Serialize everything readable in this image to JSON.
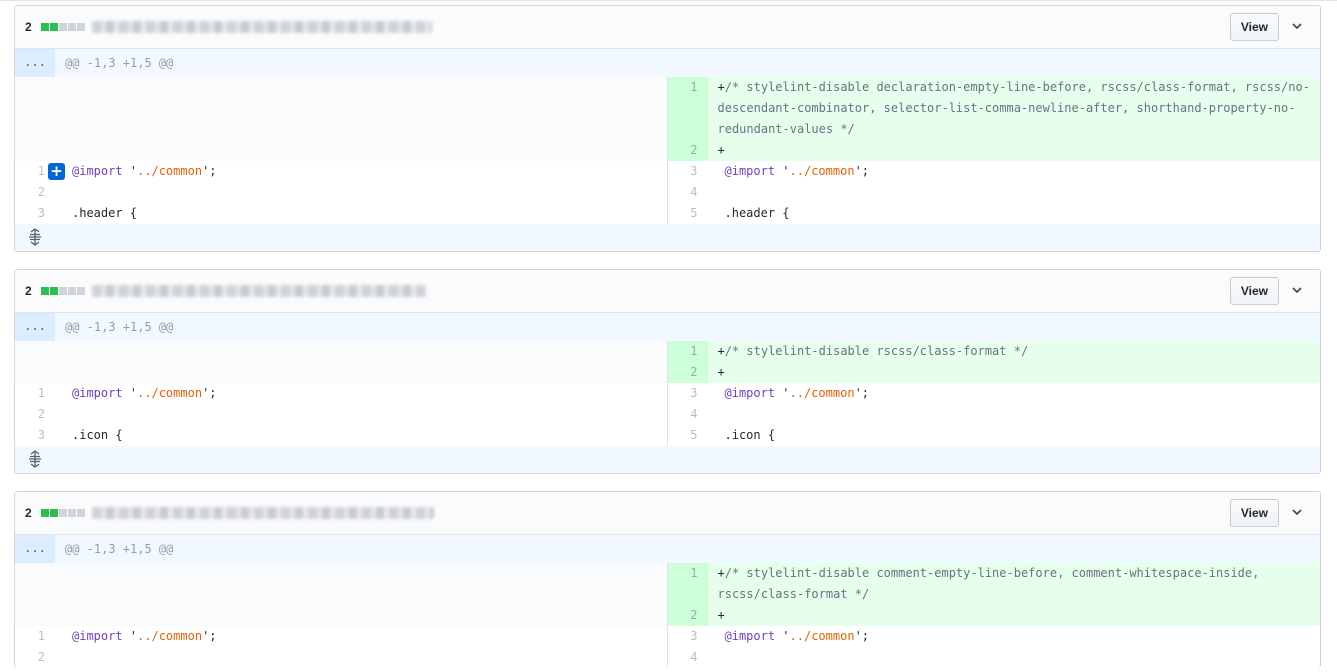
{
  "files": [
    {
      "diffstat": "2",
      "view_label": "View",
      "hunk_dots": "...",
      "hunk_header": "@@ -1,3 +1,5 @@",
      "added": [
        {
          "num": "1",
          "prefix": "+",
          "text": "/* stylelint-disable declaration-empty-line-before, rscss/class-format, rscss/no-descendant-combinator, selector-list-comma-newline-after, shorthand-property-no-redundant-values */"
        },
        {
          "num": "2",
          "prefix": "+",
          "text": ""
        }
      ],
      "left": [
        {
          "num": "1",
          "text_a": "@import",
          "text_b": " '",
          "text_c": "../common",
          "text_d": "';"
        },
        {
          "num": "2",
          "text_a": "",
          "text_b": "",
          "text_c": "",
          "text_d": ""
        },
        {
          "num": "3",
          "text_a": "",
          "text_b": ".header {",
          "text_c": "",
          "text_d": ""
        }
      ],
      "right": [
        {
          "num": "3",
          "text_a": "@import",
          "text_b": " '",
          "text_c": "../common",
          "text_d": "';"
        },
        {
          "num": "4",
          "text_a": "",
          "text_b": "",
          "text_c": "",
          "text_d": ""
        },
        {
          "num": "5",
          "text_a": "",
          "text_b": ".header {",
          "text_c": "",
          "text_d": ""
        }
      ],
      "add_button": "+"
    },
    {
      "diffstat": "2",
      "view_label": "View",
      "hunk_dots": "...",
      "hunk_header": "@@ -1,3 +1,5 @@",
      "added": [
        {
          "num": "1",
          "prefix": "+",
          "text": "/* stylelint-disable rscss/class-format */"
        },
        {
          "num": "2",
          "prefix": "+",
          "text": ""
        }
      ],
      "left": [
        {
          "num": "1",
          "text_a": "@import",
          "text_b": " '",
          "text_c": "../common",
          "text_d": "';"
        },
        {
          "num": "2",
          "text_a": "",
          "text_b": "",
          "text_c": "",
          "text_d": ""
        },
        {
          "num": "3",
          "text_a": "",
          "text_b": ".icon {",
          "text_c": "",
          "text_d": ""
        }
      ],
      "right": [
        {
          "num": "3",
          "text_a": "@import",
          "text_b": " '",
          "text_c": "../common",
          "text_d": "';"
        },
        {
          "num": "4",
          "text_a": "",
          "text_b": "",
          "text_c": "",
          "text_d": ""
        },
        {
          "num": "5",
          "text_a": "",
          "text_b": ".icon {",
          "text_c": "",
          "text_d": ""
        }
      ]
    },
    {
      "diffstat": "2",
      "view_label": "View",
      "hunk_dots": "...",
      "hunk_header": "@@ -1,3 +1,5 @@",
      "added": [
        {
          "num": "1",
          "prefix": "+",
          "text": "/* stylelint-disable comment-empty-line-before, comment-whitespace-inside, rscss/class-format */"
        },
        {
          "num": "2",
          "prefix": "+",
          "text": ""
        }
      ],
      "left": [
        {
          "num": "1",
          "text_a": "@import",
          "text_b": " '",
          "text_c": "../common",
          "text_d": "';"
        },
        {
          "num": "2",
          "text_a": "",
          "text_b": "",
          "text_c": "",
          "text_d": ""
        }
      ],
      "right": [
        {
          "num": "3",
          "text_a": "@import",
          "text_b": " '",
          "text_c": "../common",
          "text_d": "';"
        },
        {
          "num": "4",
          "text_a": "",
          "text_b": "",
          "text_c": "",
          "text_d": ""
        }
      ]
    }
  ]
}
